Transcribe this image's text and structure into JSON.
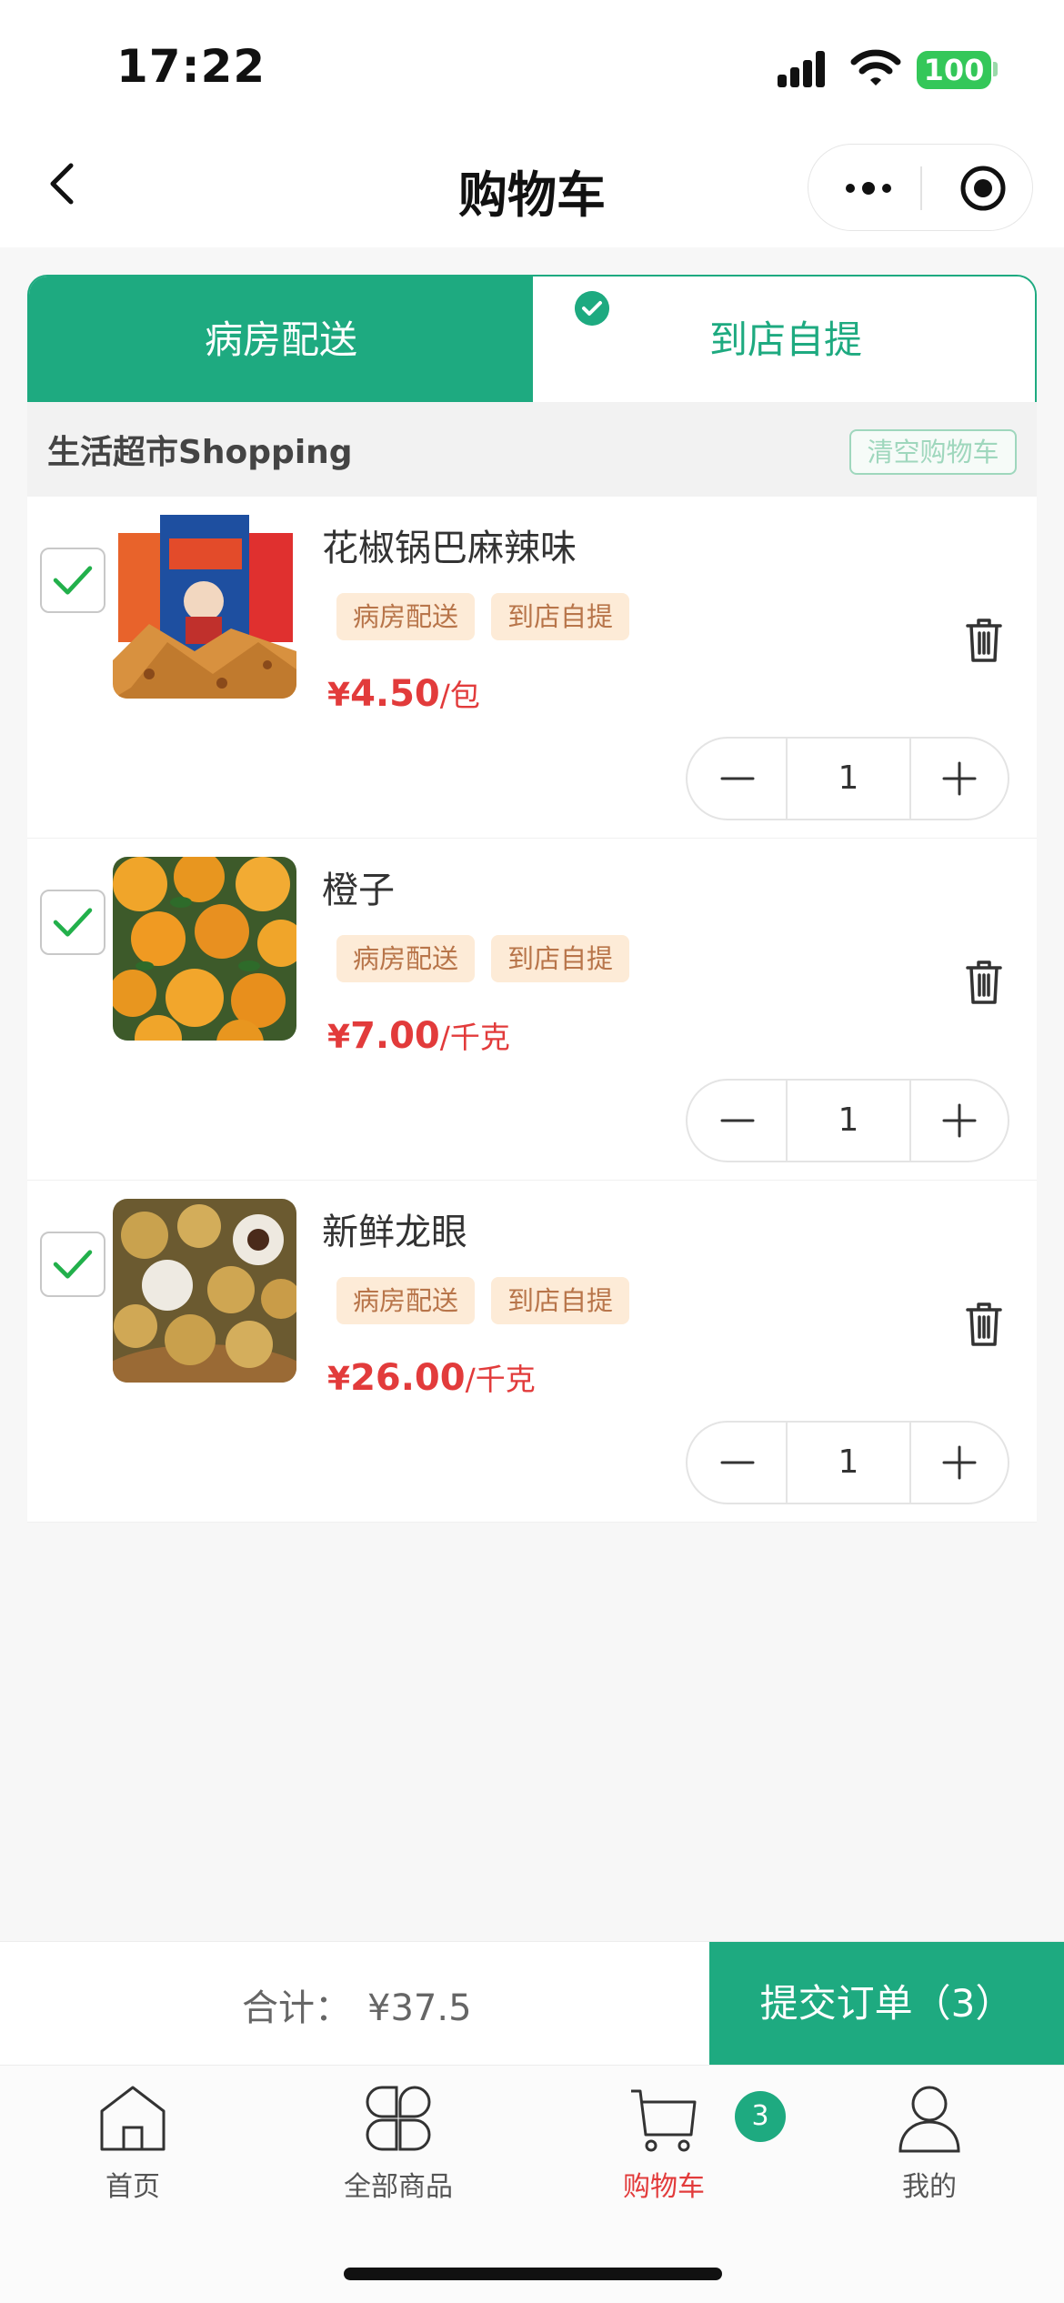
{
  "status_bar": {
    "time": "17:22",
    "battery": "100"
  },
  "nav": {
    "title": "购物车"
  },
  "delivery_tabs": {
    "ward": "病房配送",
    "store": "到店自提"
  },
  "shop": {
    "name": "生活超市Shopping",
    "clear_label": "清空购物车"
  },
  "items": [
    {
      "name": "花椒锅巴麻辣味",
      "tags": [
        "病房配送",
        "到店自提"
      ],
      "price_symbol": "¥",
      "price": "4.50",
      "unit": "/包",
      "qty": "1",
      "checked": true
    },
    {
      "name": "橙子",
      "tags": [
        "病房配送",
        "到店自提"
      ],
      "price_symbol": "¥",
      "price": "7.00",
      "unit": "/千克",
      "qty": "1",
      "checked": true
    },
    {
      "name": "新鲜龙眼",
      "tags": [
        "病房配送",
        "到店自提"
      ],
      "price_symbol": "¥",
      "price": "26.00",
      "unit": "/千克",
      "qty": "1",
      "checked": true
    }
  ],
  "summary": {
    "total_label": "合计：",
    "total_value": "¥37.5",
    "submit_label": "提交订单（3）"
  },
  "tab_bar": {
    "items": [
      {
        "label": "首页",
        "icon": "home-icon"
      },
      {
        "label": "全部商品",
        "icon": "grid-icon"
      },
      {
        "label": "购物车",
        "icon": "cart-icon",
        "active": true
      },
      {
        "label": "我的",
        "icon": "user-icon"
      }
    ],
    "cart_badge": "3"
  },
  "colors": {
    "brand": "#1eaa80",
    "price": "#e23b3b",
    "tag_bg": "#fdebd7",
    "tag_text": "#b8754a"
  }
}
